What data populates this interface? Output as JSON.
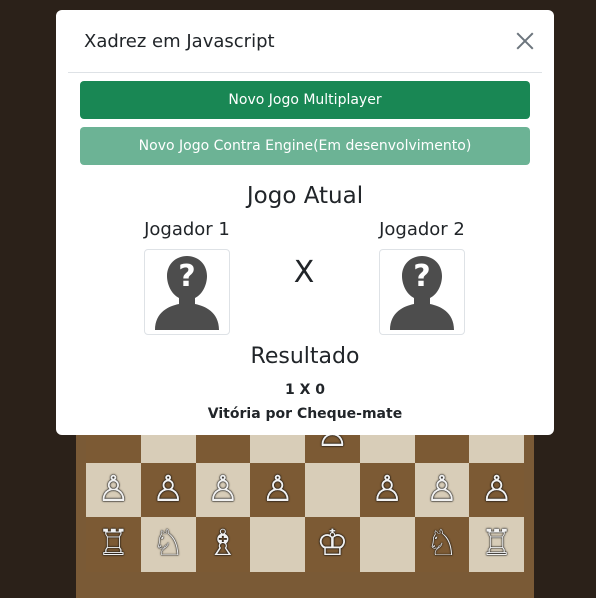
{
  "modal": {
    "title": "Xadrez em Javascript",
    "buttons": {
      "multiplayer": "Novo Jogo Multiplayer",
      "engine": "Novo Jogo Contra Engine(Em desenvolvimento)"
    },
    "current_game_title": "Jogo Atual",
    "player1": "Jogador 1",
    "player2": "Jogador 2",
    "vs": "X",
    "result_title": "Resultado",
    "score": "1 X 0",
    "reason": "Vitória por Cheque-mate",
    "avatar_icon": "unknown-user-icon"
  },
  "board": {
    "rows": [
      [
        "",
        "",
        "",
        "",
        "♙",
        "",
        "",
        ""
      ],
      [
        "♙",
        "♙",
        "♙",
        "♙",
        "",
        "♙",
        "♙",
        "♙"
      ],
      [
        "♖",
        "♘",
        "♗",
        "",
        "♔",
        "",
        "♘",
        "♖"
      ]
    ]
  }
}
